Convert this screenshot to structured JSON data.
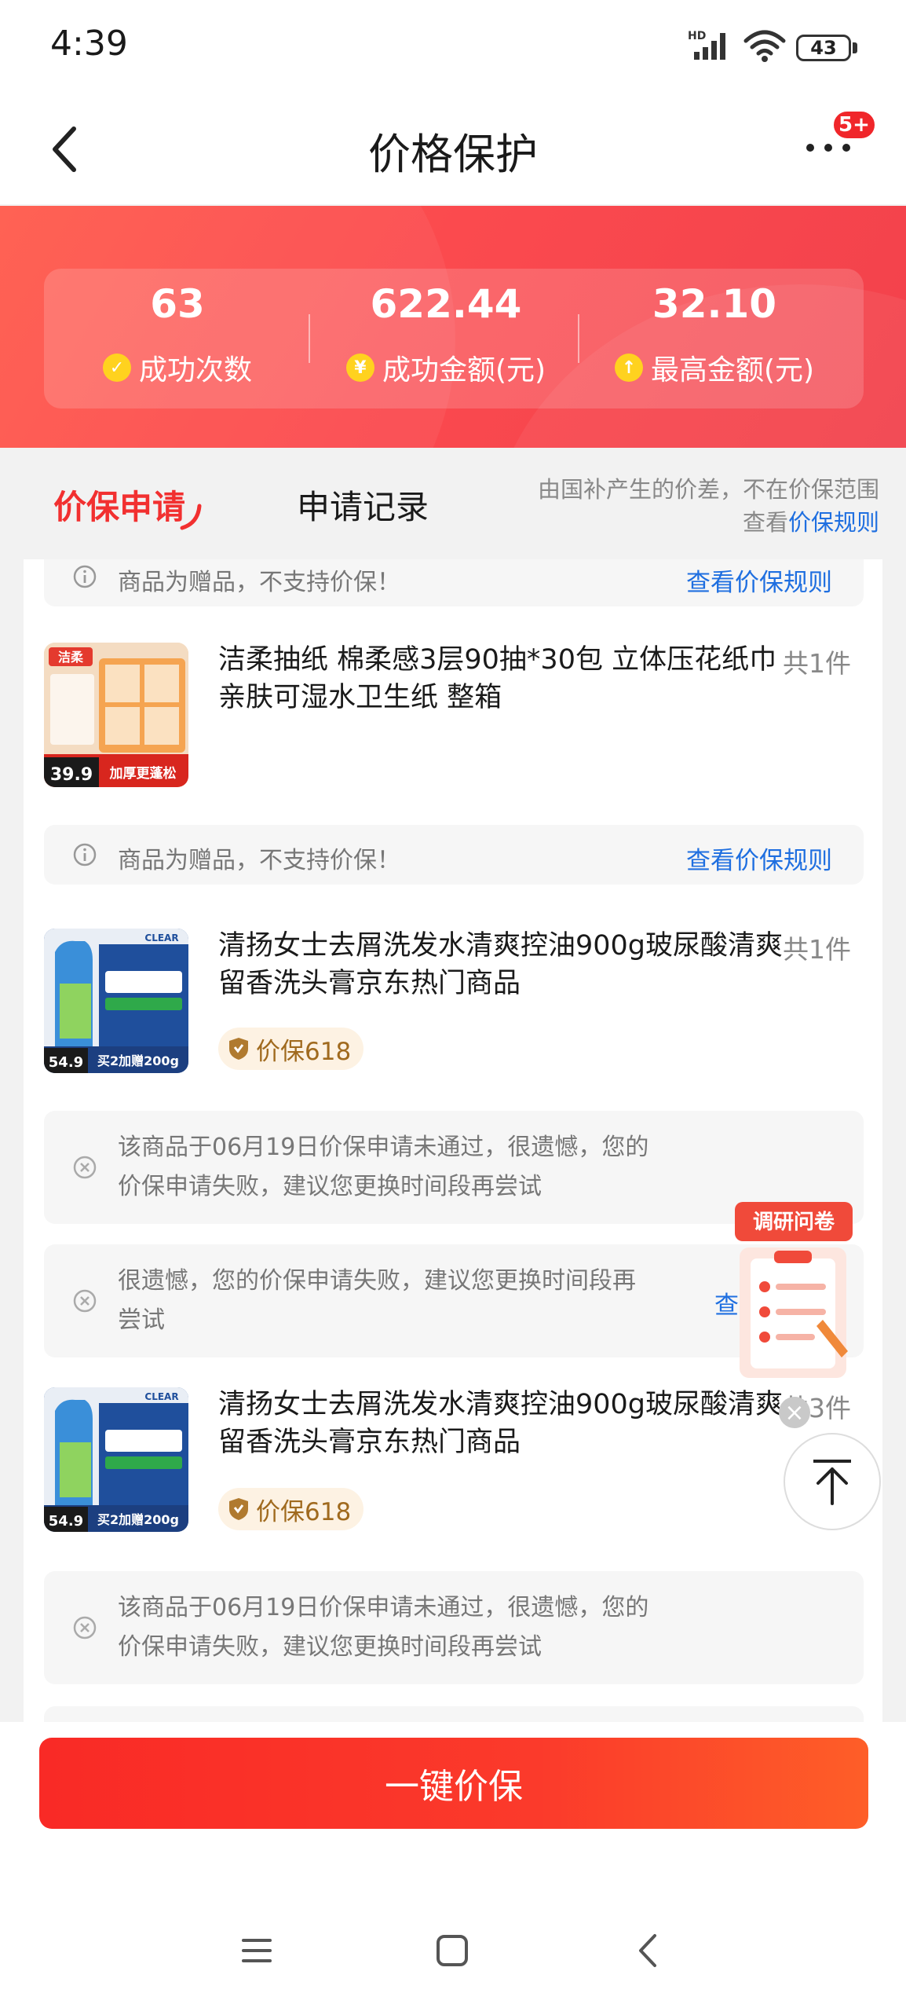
{
  "status_bar": {
    "time": "4:39",
    "network": "HD",
    "battery": "43"
  },
  "nav": {
    "title": "价格保护",
    "badge": "5+"
  },
  "stats": [
    {
      "value": "63",
      "label": "成功次数",
      "icon": "check-circle-icon"
    },
    {
      "value": "622.44",
      "label": "成功金额(元)",
      "icon": "yen-circle-icon"
    },
    {
      "value": "32.10",
      "label": "最高金额(元)",
      "icon": "up-arrow-circle-icon"
    }
  ],
  "tabs": {
    "apply": "价保申请",
    "records": "申请记录"
  },
  "notice": {
    "line1": "由国补产生的价差，不在价保范围",
    "prefix": "查看",
    "link": "价保规则"
  },
  "items": {
    "gift_text": "商品为赠品，不支持价保！",
    "rule_link": "查看价保规则",
    "product1": {
      "title": "洁柔抽纸 棉柔感3层90抽*30包 立体压花纸巾 亲肤可湿水卫生纸 整箱",
      "count": "共1件",
      "thumb_price": "39.9",
      "thumb_brand": "洁柔",
      "thumb_tag": "加厚更蓬松"
    },
    "product2": {
      "title": "清扬女士去屑洗发水清爽控油900g玻尿酸清爽留香洗头膏京东热门商品",
      "count": "共1件",
      "tag": "价保618",
      "thumb_price": "54.9",
      "thumb_brand": "CLEAR",
      "thumb_tag": "买2加赠200g"
    },
    "fail1": "该商品于06月19日价保申请未通过，很遗憾，您的价保申请失败，建议您更换时间段再尝试",
    "fail2": "很遗憾，您的价保申请失败，建议您更换时间段再尝试",
    "fail2_link": "查看",
    "product3": {
      "title": "清扬女士去屑洗发水清爽控油900g玻尿酸清爽留香洗头膏京东热门商品",
      "count": "共3件",
      "tag": "价保618",
      "thumb_price": "54.9",
      "thumb_brand": "CLEAR",
      "thumb_tag": "买2加赠200g"
    },
    "fail3": "该商品于06月19日价保申请未通过，很遗憾，您的价保申请失败，建议您更换时间段再尝试"
  },
  "survey": {
    "label": "调研问卷"
  },
  "bottom": {
    "button": "一键价保"
  },
  "colors": {
    "accent": "#f23030",
    "link": "#1f6fe0",
    "tag_bg": "#fdf2e3",
    "tag_text": "#a06a1e"
  }
}
